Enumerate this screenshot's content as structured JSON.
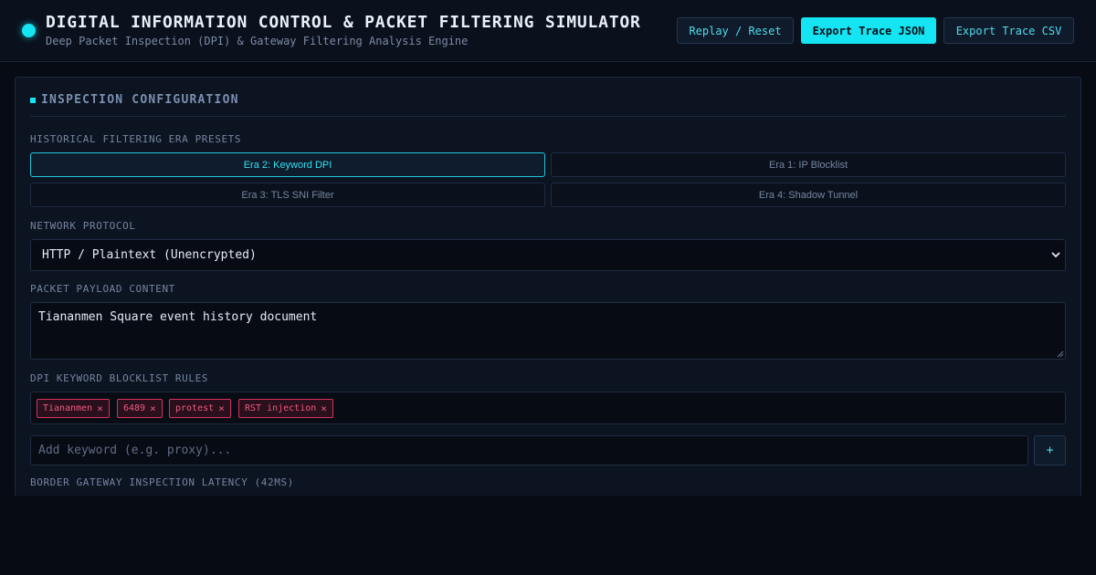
{
  "header": {
    "title": "DIGITAL INFORMATION CONTROL & PACKET FILTERING SIMULATOR",
    "subtitle": "Deep Packet Inspection (DPI) & Gateway Filtering Analysis Engine",
    "buttons": {
      "reset": "Replay / Reset",
      "export_json": "Export Trace JSON",
      "export_csv": "Export Trace CSV"
    }
  },
  "panel": {
    "title": "INSPECTION CONFIGURATION",
    "era_label": "HISTORICAL FILTERING ERA PRESETS",
    "eras": [
      {
        "label": "Era 2: Keyword DPI",
        "active": true
      },
      {
        "label": "Era 1: IP Blocklist",
        "active": false
      },
      {
        "label": "Era 3: TLS SNI Filter",
        "active": false
      },
      {
        "label": "Era 4: Shadow Tunnel",
        "active": false
      }
    ],
    "protocol_label": "NETWORK PROTOCOL",
    "protocol_value": "HTTP / Plaintext (Unencrypted)",
    "payload_label": "PACKET PAYLOAD CONTENT",
    "payload_value": "Tiananmen Square event history document",
    "rules_label": "DPI KEYWORD BLOCKLIST RULES",
    "keywords": [
      "Tiananmen",
      "6489",
      "protest",
      "RST injection"
    ],
    "tag_remove_glyph": "×",
    "keyword_placeholder": "Add keyword (e.g. proxy)...",
    "add_button": "+",
    "latency_label": "BORDER GATEWAY INSPECTION LATENCY (42MS)"
  },
  "colors": {
    "accent": "#15e4f2",
    "background": "#070b14",
    "tag_border": "#d4335c",
    "tag_text": "#f05a7e"
  }
}
